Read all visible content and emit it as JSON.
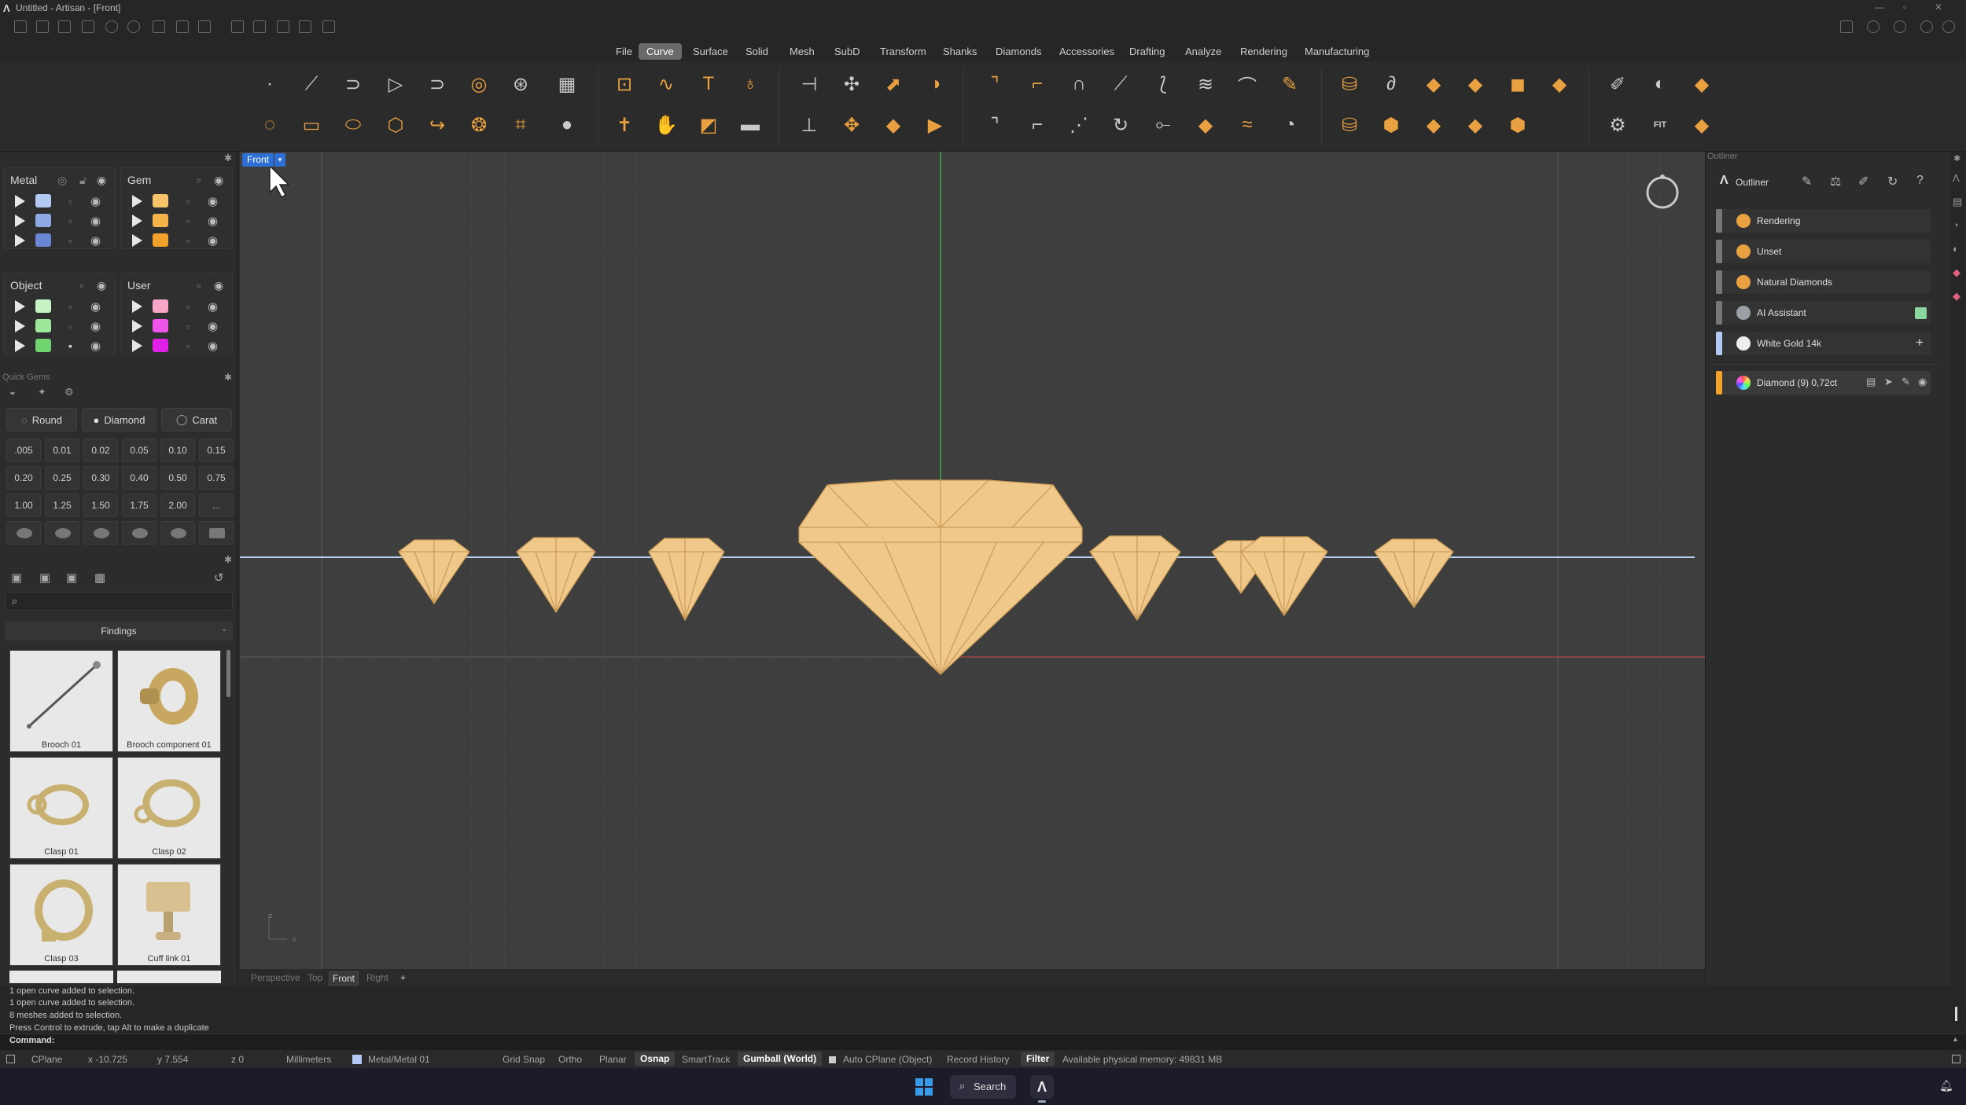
{
  "window": {
    "title": "Untitled - Artisan - [Front]"
  },
  "menu": {
    "items": [
      "File",
      "Curve",
      "Surface",
      "Solid",
      "Mesh",
      "SubD",
      "Transform",
      "Shanks",
      "Diamonds",
      "Accessories",
      "Drafting",
      "Analyze",
      "Rendering",
      "Manufacturing"
    ],
    "active": "Curve"
  },
  "layers": {
    "groups": [
      {
        "title": "Metal",
        "colors": [
          "#b4c8f4",
          "#8fa9e4",
          "#6a87d6"
        ]
      },
      {
        "title": "Gem",
        "colors": [
          "#f7c46a",
          "#f5b24a",
          "#f2a22a"
        ]
      },
      {
        "title": "Object",
        "colors": [
          "#c6f3c6",
          "#9be89b",
          "#6fd36f"
        ]
      },
      {
        "title": "User",
        "colors": [
          "#f7a6c8",
          "#ee55e8",
          "#e020e6"
        ]
      }
    ]
  },
  "quick_gems": {
    "title": "Quick Gems",
    "shape_label": "Round",
    "type_label": "Diamond",
    "unit_label": "Carat",
    "carats": [
      ".005",
      "0.01",
      "0.02",
      "0.05",
      "0.10",
      "0.15",
      "0.20",
      "0.25",
      "0.30",
      "0.40",
      "0.50",
      "0.75",
      "1.00",
      "1.25",
      "1.50",
      "1.75",
      "2.00",
      "..."
    ]
  },
  "library": {
    "category": "Findings",
    "items": [
      "Brooch 01",
      "Brooch component 01",
      "Clasp 01",
      "Clasp 02",
      "Clasp 03",
      "Cuff link 01"
    ]
  },
  "viewport": {
    "name": "Front",
    "tabs": [
      "Perspective",
      "Top",
      "Front",
      "Right"
    ],
    "active_tab": "Front"
  },
  "outliner": {
    "title": "Outliner",
    "panel_label": "Outliner",
    "items": [
      {
        "label": "Rendering",
        "color": "#e8a040"
      },
      {
        "label": "Unset",
        "color": "#e8a040"
      },
      {
        "label": "Natural Diamonds",
        "color": "#e8a040"
      },
      {
        "label": "AI Assistant",
        "color": "#9aa0a6"
      },
      {
        "label": "White Gold 14k",
        "color": "#eeeeee"
      }
    ],
    "selected": {
      "label": "Diamond (9) 0,72ct"
    }
  },
  "command": {
    "history": [
      "1 open curve added to selection.",
      "1 open curve added to selection.",
      "8 meshes added to selection.",
      "Press Control to extrude, tap Alt to make a duplicate"
    ],
    "prompt": "Command:"
  },
  "status": {
    "cplane": "CPlane",
    "x": "x -10.725",
    "y": "y 7.554",
    "z": "z 0",
    "units": "Millimeters",
    "layer": "Metal/Metal 01",
    "grid_snap": "Grid Snap",
    "ortho": "Ortho",
    "planar": "Planar",
    "osnap": "Osnap",
    "smarttrack": "SmartTrack",
    "gumball": "Gumball (World)",
    "auto_cplane": "Auto CPlane (Object)",
    "record_history": "Record History",
    "filter": "Filter",
    "memory": "Available physical memory: 49831 MB"
  },
  "taskbar": {
    "search": "Search"
  }
}
